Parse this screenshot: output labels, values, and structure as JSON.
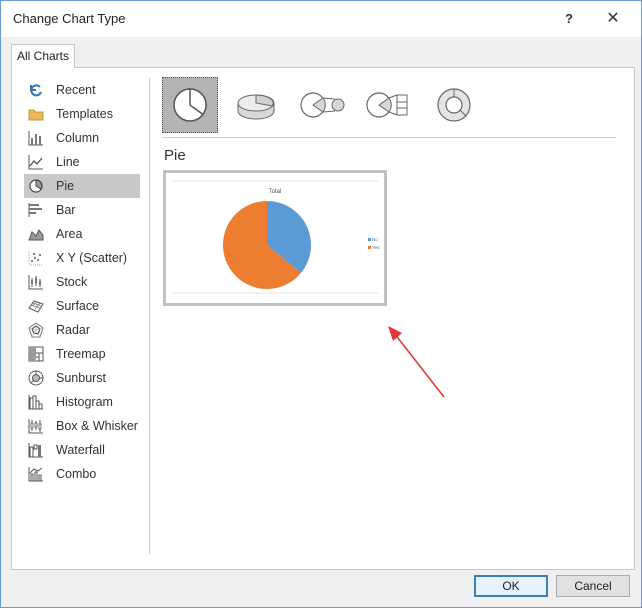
{
  "window": {
    "title": "Change Chart Type",
    "help_label": "?",
    "close_label": "✕"
  },
  "tabs": [
    {
      "label": "All Charts"
    }
  ],
  "sidebar": {
    "items": [
      {
        "label": "Recent",
        "icon": "recent-icon"
      },
      {
        "label": "Templates",
        "icon": "templates-folder-icon"
      },
      {
        "label": "Column",
        "icon": "column-chart-icon"
      },
      {
        "label": "Line",
        "icon": "line-chart-icon"
      },
      {
        "label": "Pie",
        "icon": "pie-chart-icon",
        "selected": true
      },
      {
        "label": "Bar",
        "icon": "bar-chart-icon"
      },
      {
        "label": "Area",
        "icon": "area-chart-icon"
      },
      {
        "label": "X Y (Scatter)",
        "icon": "scatter-chart-icon"
      },
      {
        "label": "Stock",
        "icon": "stock-chart-icon"
      },
      {
        "label": "Surface",
        "icon": "surface-chart-icon"
      },
      {
        "label": "Radar",
        "icon": "radar-chart-icon"
      },
      {
        "label": "Treemap",
        "icon": "treemap-chart-icon"
      },
      {
        "label": "Sunburst",
        "icon": "sunburst-chart-icon"
      },
      {
        "label": "Histogram",
        "icon": "histogram-chart-icon"
      },
      {
        "label": "Box & Whisker",
        "icon": "box-whisker-chart-icon"
      },
      {
        "label": "Waterfall",
        "icon": "waterfall-chart-icon"
      },
      {
        "label": "Combo",
        "icon": "combo-chart-icon"
      }
    ]
  },
  "subtypes": [
    {
      "icon": "pie-icon",
      "selected": true
    },
    {
      "icon": "3d-pie-icon"
    },
    {
      "icon": "pie-of-pie-icon"
    },
    {
      "icon": "bar-of-pie-icon"
    },
    {
      "icon": "doughnut-icon"
    }
  ],
  "section_title": "Pie",
  "preview_chart": {
    "title": "Total",
    "legend": [
      "No",
      "Yes"
    ]
  },
  "chart_data": {
    "type": "pie",
    "title": "Total",
    "categories": [
      "No",
      "Yes"
    ],
    "values": [
      36,
      64
    ],
    "colors": [
      "#5b9bd5",
      "#ed7d31"
    ],
    "legend_position": "right"
  },
  "colors": {
    "accent": "#3c7fb1",
    "selection": "#c8c8c8",
    "arrow": "#e53935",
    "pie_blue": "#5b9bd5",
    "pie_orange": "#ed7d31"
  },
  "buttons": {
    "ok": "OK",
    "cancel": "Cancel"
  }
}
